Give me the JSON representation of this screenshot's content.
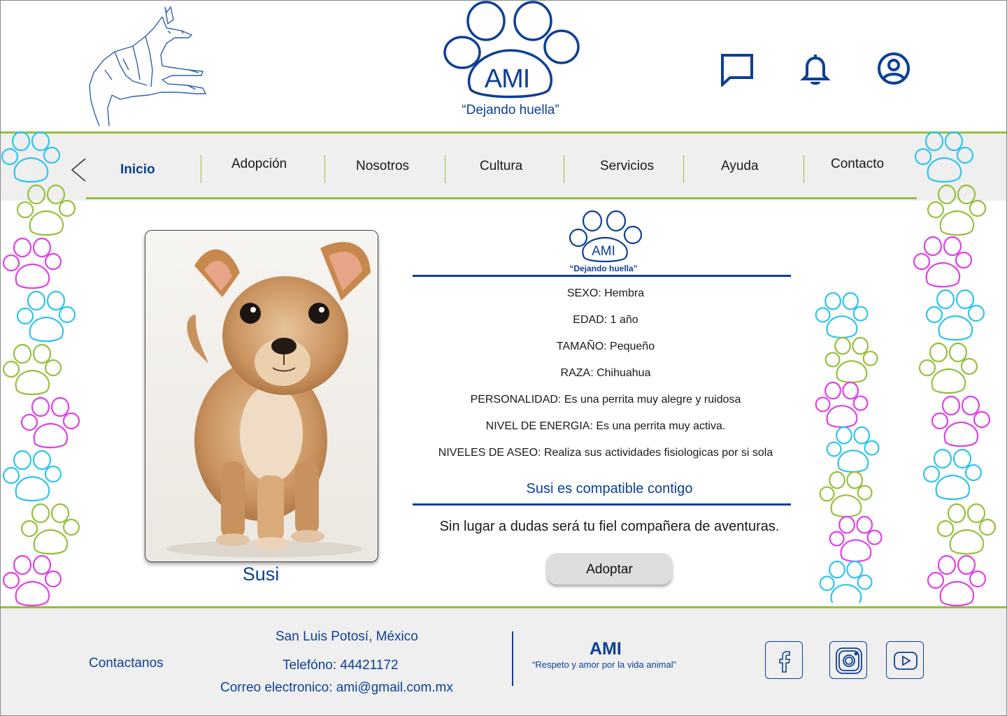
{
  "header": {
    "logo_name": "AMI",
    "logo_tagline": "“Dejando huella”",
    "icons": [
      "chat-icon",
      "bell-icon",
      "user-circle-icon"
    ]
  },
  "nav": {
    "items": [
      {
        "label": "Inicio",
        "active": true
      },
      {
        "label": "Adopción",
        "active": false
      },
      {
        "label": "Nosotros",
        "active": false
      },
      {
        "label": "Cultura",
        "active": false
      },
      {
        "label": "Servicios",
        "active": false
      },
      {
        "label": "Ayuda",
        "active": false
      },
      {
        "label": "Contacto",
        "active": false
      }
    ]
  },
  "pet": {
    "name": "Susi",
    "logo_name": "AMI",
    "logo_tagline": "“Dejando huella”",
    "details": [
      "SEXO:  Hembra",
      "EDAD: 1 año",
      "TAMAÑO: Pequeño",
      "RAZA: Chihuahua",
      "PERSONALIDAD: Es una perrita muy alegre y ruidosa",
      "NIVEL DE ENERGIA: Es una perrita muy activa.",
      "NIVELES DE ASEO: Realiza sus actividades fisiologicas por si sola"
    ],
    "compatibility": "Susi es compatible contigo",
    "summary": "Sin lugar a dudas será tu fiel compañera de aventuras.",
    "adopt_label": "Adoptar"
  },
  "footer": {
    "contact_label": "Contactanos",
    "location": "San Luis Potosí, México",
    "phone": "Telefóno: 44421172",
    "email": "Correo electronico: ami@gmail.com.mx",
    "brand": "AMI",
    "slogan": "“Respeto y amor por la vida animal”",
    "social": [
      "facebook-icon",
      "instagram-icon",
      "youtube-icon"
    ]
  },
  "colors": {
    "brand_blue": "#0d3f96",
    "green": "#96c03c",
    "cyan": "#2ec4ee",
    "magenta": "#e040e8",
    "band_gray": "#efefef"
  }
}
